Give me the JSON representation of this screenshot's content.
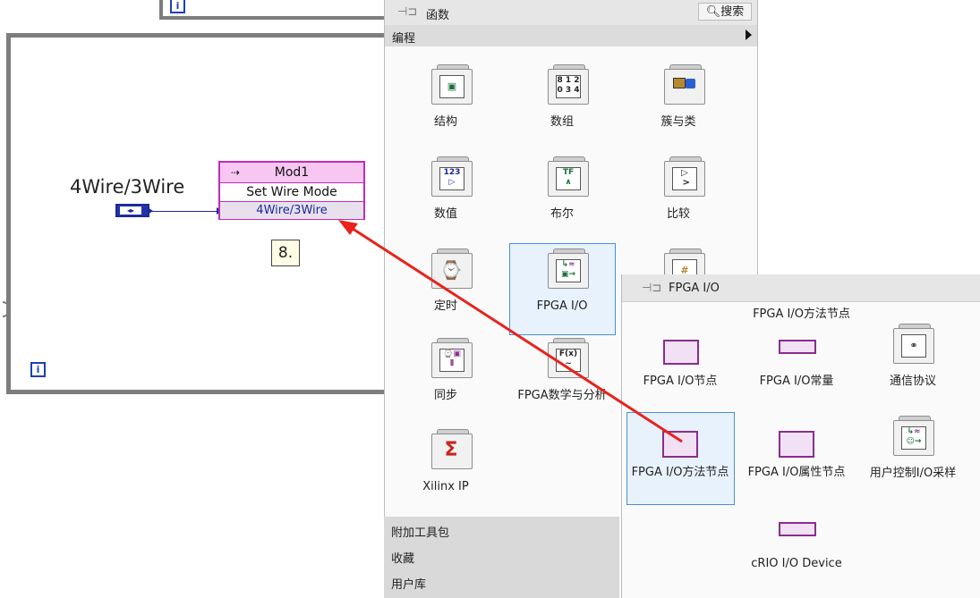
{
  "block_diagram": {
    "control_label": "4Wire/3Wire",
    "iteration_terminal": "i",
    "node": {
      "resource": "Mod1",
      "method": "Set Wire Mode",
      "parameter": "4Wire/3Wire"
    },
    "step_label": "8."
  },
  "palette": {
    "title": "函数",
    "search_label": "搜索",
    "category": "编程",
    "items": [
      {
        "label": "结构",
        "icon": "structures-icon"
      },
      {
        "label": "数组",
        "icon": "array-icon"
      },
      {
        "label": "簇与类",
        "icon": "cluster-class-icon"
      },
      {
        "label": "数值",
        "icon": "numeric-icon"
      },
      {
        "label": "布尔",
        "icon": "boolean-icon"
      },
      {
        "label": "比较",
        "icon": "comparison-icon"
      },
      {
        "label": "定时",
        "icon": "timing-icon"
      },
      {
        "label": "FPGA I/O",
        "icon": "fpga-io-icon"
      },
      {
        "label": "同步",
        "icon": "synchronization-icon"
      },
      {
        "label": "FPGA数学与分析",
        "icon": "fpga-math-icon"
      },
      {
        "label": "Xilinx IP",
        "icon": "xilinx-ip-icon"
      }
    ],
    "footer": [
      "附加工具包",
      "收藏",
      "用户库"
    ]
  },
  "sub_palette": {
    "title": "FPGA I/O",
    "section": "FPGA I/O方法节点",
    "items": [
      {
        "label": "FPGA I/O节点",
        "icon": "fpga-io-node-icon"
      },
      {
        "label": "FPGA I/O常量",
        "icon": "fpga-io-constant-icon"
      },
      {
        "label": "通信协议",
        "icon": "communication-protocol-icon"
      },
      {
        "label": "FPGA I/O方法节点",
        "icon": "fpga-io-method-node-icon"
      },
      {
        "label": "FPGA I/O属性节点",
        "icon": "fpga-io-property-node-icon"
      },
      {
        "label": "用户控制I/O采样",
        "icon": "user-controlled-io-sampling-icon"
      },
      {
        "label": "cRIO I/O Device",
        "icon": "crio-io-device-icon"
      }
    ]
  },
  "colors": {
    "annotation_arrow": "#e8231c",
    "wire": "#1a2a99",
    "method_node": "#c02cb8",
    "highlight": "#4a8fd6"
  }
}
